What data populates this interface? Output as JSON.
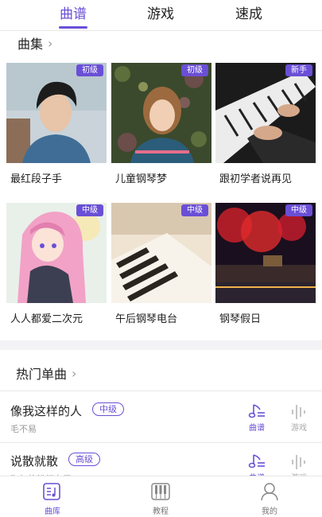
{
  "tabs": [
    {
      "label": "曲谱",
      "active": true
    },
    {
      "label": "游戏",
      "active": false
    },
    {
      "label": "速成",
      "active": false
    }
  ],
  "collection": {
    "title": "曲集",
    "items": [
      {
        "label": "最红段子手",
        "badge": "初级"
      },
      {
        "label": "儿童钢琴梦",
        "badge": "初级"
      },
      {
        "label": "跟初学者说再见",
        "badge": "新手"
      },
      {
        "label": "人人都爱二次元",
        "badge": "中级"
      },
      {
        "label": "午后钢琴电台",
        "badge": "中级"
      },
      {
        "label": "钢琴假日",
        "badge": "中级"
      }
    ]
  },
  "hot": {
    "title": "热门单曲",
    "songs": [
      {
        "title": "像我这样的人",
        "level": "中级",
        "artist": "毛不易"
      },
      {
        "title": "说散就散",
        "level": "高级",
        "artist": "淘气的粉红女王"
      }
    ],
    "actions": {
      "sheet": "曲谱",
      "game": "游戏"
    }
  },
  "bottom_nav": [
    {
      "label": "曲库",
      "active": true
    },
    {
      "label": "教程",
      "active": false
    },
    {
      "label": "我的",
      "active": false
    }
  ],
  "colors": {
    "accent": "#6a4fd6"
  }
}
